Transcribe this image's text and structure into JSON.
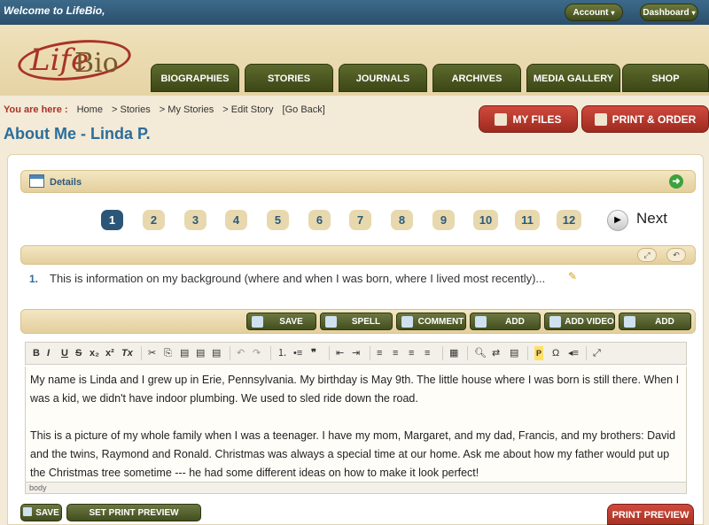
{
  "topbar": {
    "welcome": "Welcome to LifeBio,",
    "account": "Account",
    "dashboard": "Dashboard"
  },
  "logo": {
    "life": "Life",
    "bio": "Bio"
  },
  "nav": [
    "BIOGRAPHIES",
    "STORIES",
    "JOURNALS",
    "ARCHIVES",
    "MEDIA GALLERY",
    "SHOP"
  ],
  "breadcrumb": {
    "label": "You are here :",
    "items": [
      "Home",
      "> Stories",
      "> My Stories",
      "> Edit Story",
      "[Go Back]"
    ]
  },
  "page_title": "About Me - Linda P.",
  "actions": {
    "my_files": "MY FILES",
    "print_order": "PRINT & ORDER"
  },
  "details": {
    "label": "Details"
  },
  "pagination": {
    "pages": [
      "1",
      "2",
      "3",
      "4",
      "5",
      "6",
      "7",
      "8",
      "9",
      "10",
      "11",
      "12"
    ],
    "current": "1",
    "next": "Next"
  },
  "question": {
    "number": "1.",
    "text": "This is information on my background (where and when I was born, where I lived most recently)..."
  },
  "editor_buttons": [
    "SAVE",
    "SPELL CHECK",
    "COMMENT",
    "ADD AUDIO",
    "ADD VIDEO",
    "ADD PHOTO"
  ],
  "editor": {
    "paragraphs": [
      "My name is Linda and I grew up in Erie, Pennsylvania. My birthday is May 9th. The little house where I was born is still there. When I was a kid, we didn't have indoor plumbing. We used to sled ride down the road.",
      "This is a picture of my whole family when I was a teenager. I have my mom, Margaret, and my dad, Francis, and my brothers: David and the twins, Raymond and Ronald. Christmas was always a special time at our home. Ask me about how my father would put up the Christmas tree sometime --- he had some different ideas on how to make it look perfect!"
    ],
    "status": "body"
  },
  "bottom": {
    "save": "SAVE",
    "defaults": "SET PRINT PREVIEW DEFAULTS",
    "print_preview": "PRINT PREVIEW"
  },
  "colors": {
    "brand_red": "#a83326",
    "nav_olive": "#434e1f",
    "title_blue": "#2b6d9a",
    "topbar_blue": "#2a4f6b"
  }
}
